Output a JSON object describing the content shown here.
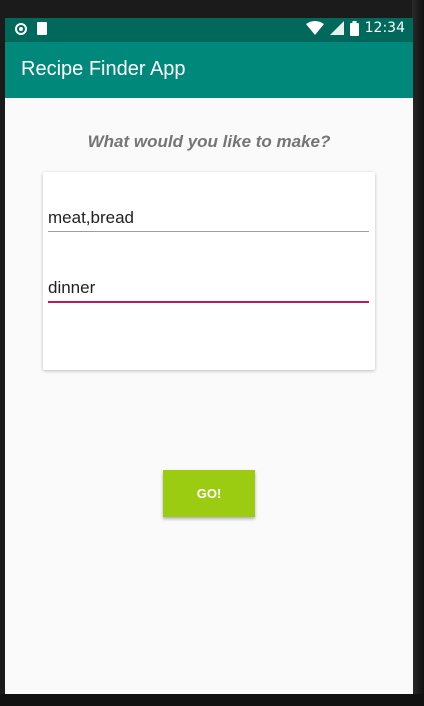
{
  "status_bar": {
    "time": "12:34",
    "icons": [
      "circle-icon",
      "sd-card-icon",
      "wifi-icon",
      "signal-icon",
      "battery-icon"
    ]
  },
  "app_bar": {
    "title": "Recipe Finder App",
    "color": "#00897b"
  },
  "main": {
    "question": "What would you like to make?",
    "ingredients_value": "meat,bread",
    "meal_value": "dinner",
    "go_label": "GO!",
    "go_color": "#9ccc12"
  }
}
